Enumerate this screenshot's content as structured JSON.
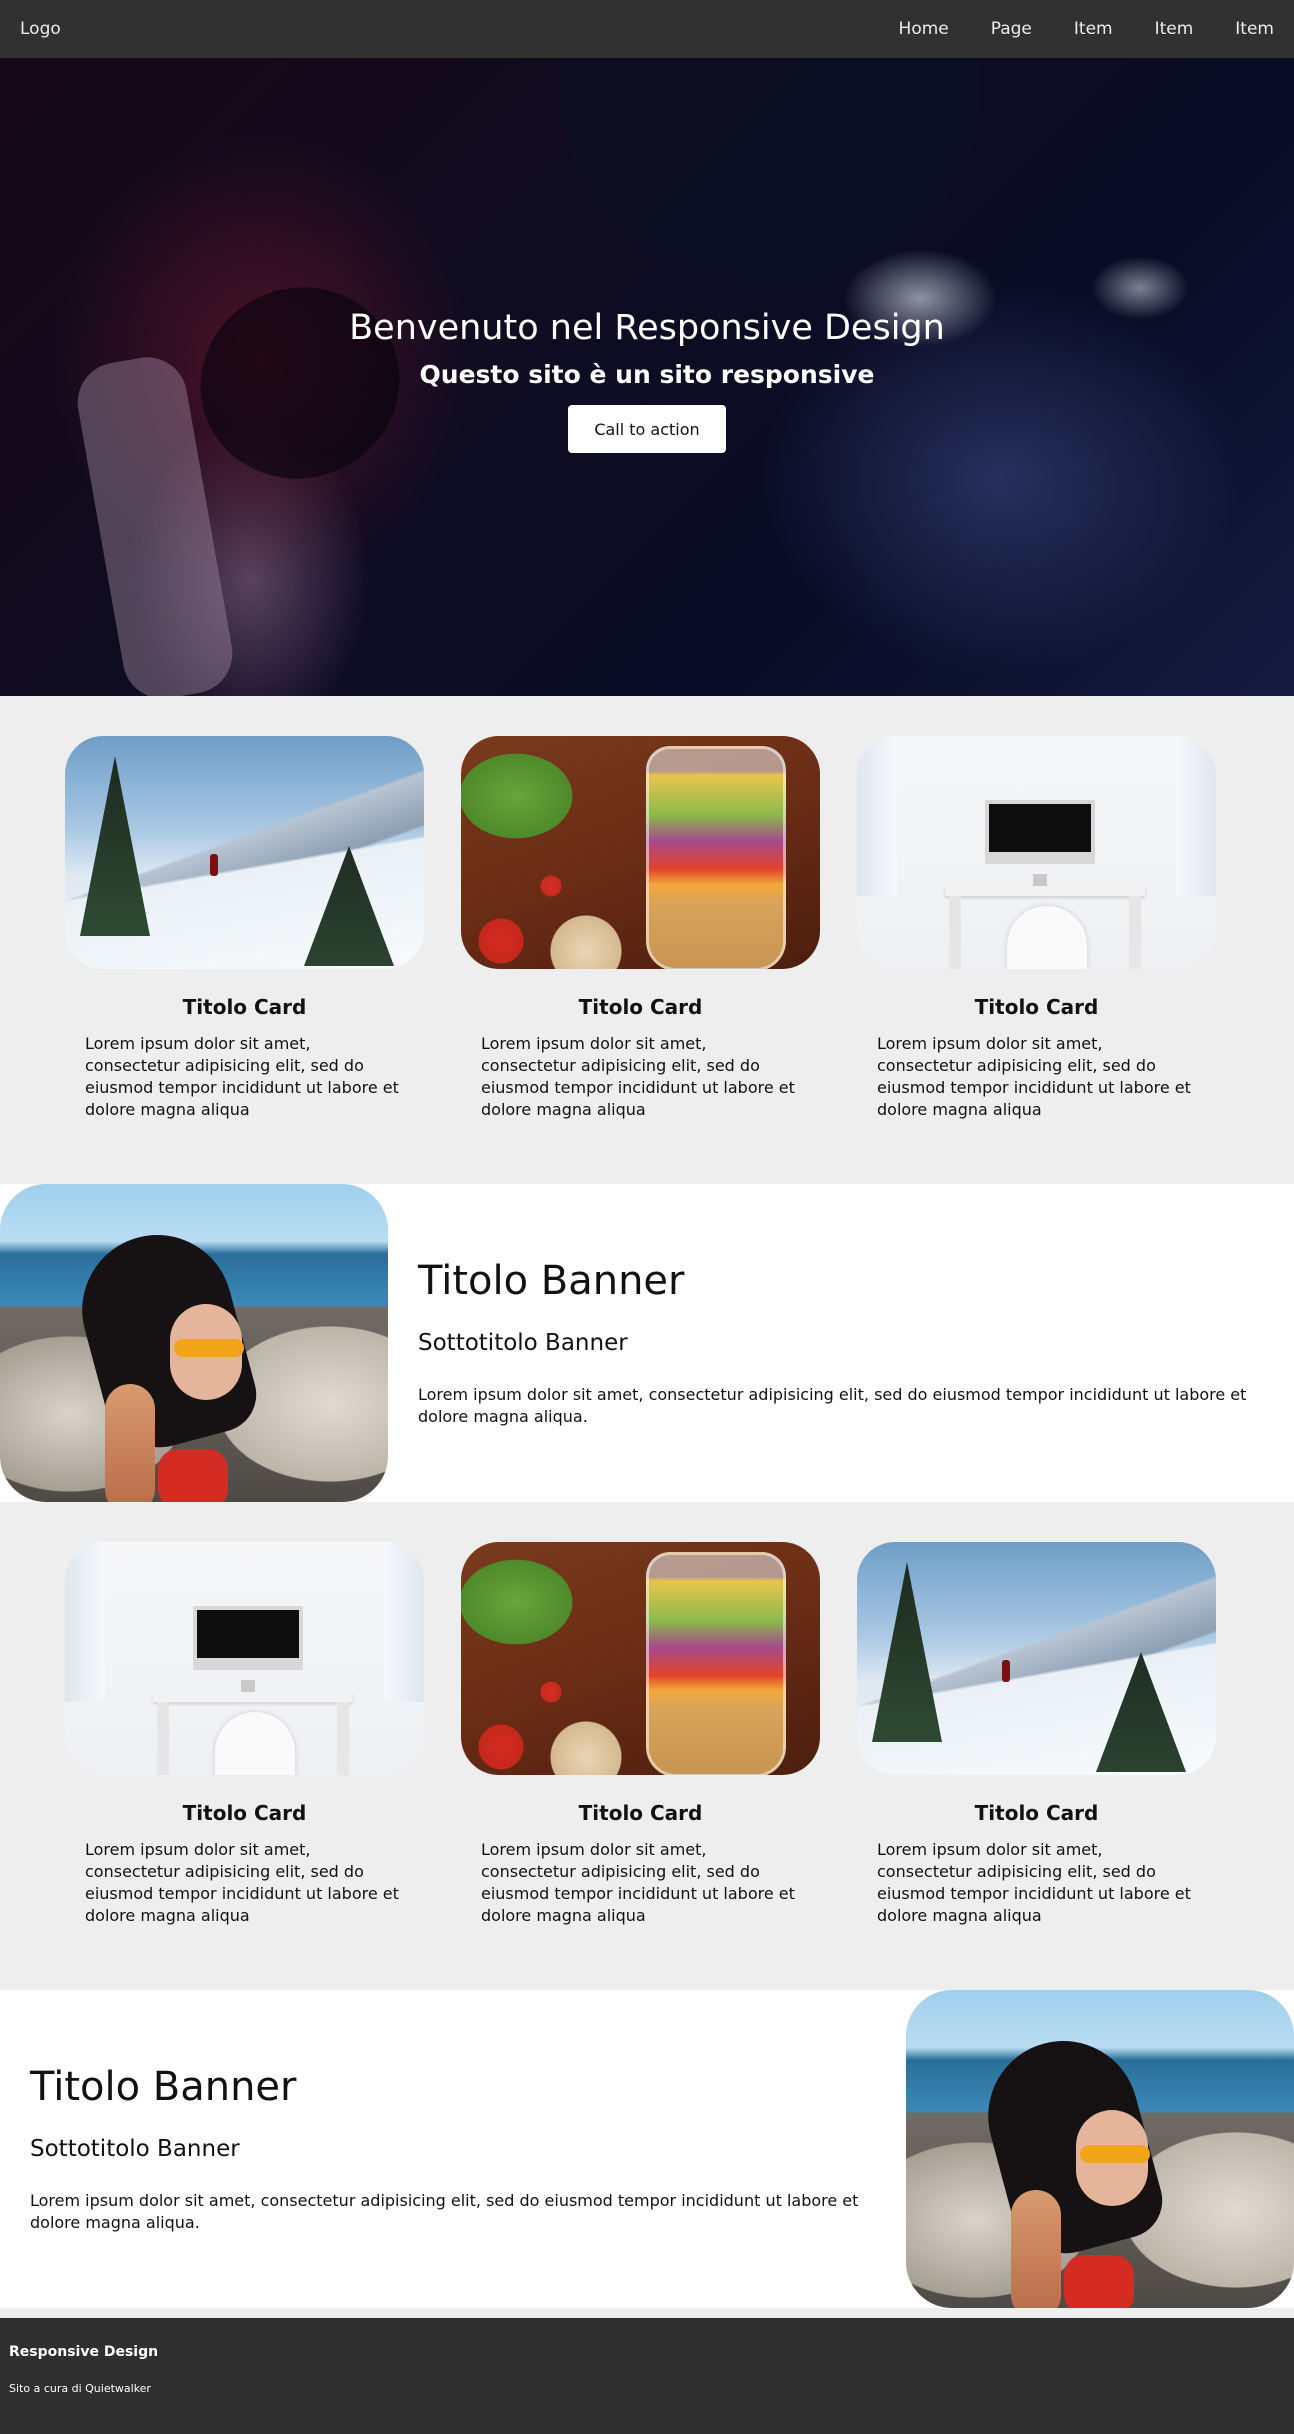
{
  "navbar": {
    "logo": "Logo",
    "links": [
      "Home",
      "Page",
      "Item",
      "Item",
      "Item"
    ]
  },
  "hero": {
    "title": "Benvenuto nel Responsive Design",
    "subtitle": "Questo sito è un sito responsive",
    "cta_label": "Call to action"
  },
  "cards_section_1": {
    "cards": [
      {
        "image": "snowy-mountain-hiker",
        "title": "Titolo Card",
        "text": "Lorem ipsum dolor sit amet, consectetur adipisicing elit, sed do eiusmod tempor incididunt ut labore et dolore magna aliqua"
      },
      {
        "image": "salad-jar",
        "title": "Titolo Card",
        "text": "Lorem ipsum dolor sit amet, consectetur adipisicing elit, sed do eiusmod tempor incididunt ut labore et dolore magna aliqua"
      },
      {
        "image": "white-desk-computer",
        "title": "Titolo Card",
        "text": "Lorem ipsum dolor sit amet, consectetur adipisicing elit, sed do eiusmod tempor incididunt ut labore et dolore magna aliqua"
      }
    ]
  },
  "banner_1": {
    "image": "woman-sunglasses-beach",
    "title": "Titolo Banner",
    "subtitle": "Sottotitolo Banner",
    "body": "Lorem ipsum dolor sit amet, consectetur adipisicing elit, sed do eiusmod tempor incididunt ut labore et dolore magna aliqua."
  },
  "cards_section_2": {
    "cards": [
      {
        "image": "white-desk-computer",
        "title": "Titolo Card",
        "text": "Lorem ipsum dolor sit amet, consectetur adipisicing elit, sed do eiusmod tempor incididunt ut labore et dolore magna aliqua"
      },
      {
        "image": "salad-jar",
        "title": "Titolo Card",
        "text": "Lorem ipsum dolor sit amet, consectetur adipisicing elit, sed do eiusmod tempor incididunt ut labore et dolore magna aliqua"
      },
      {
        "image": "snowy-mountain-hiker",
        "title": "Titolo Card",
        "text": "Lorem ipsum dolor sit amet, consectetur adipisicing elit, sed do eiusmod tempor incididunt ut labore et dolore magna aliqua"
      }
    ]
  },
  "banner_2": {
    "image": "woman-sunglasses-beach",
    "title": "Titolo Banner",
    "subtitle": "Sottotitolo Banner",
    "body": "Lorem ipsum dolor sit amet, consectetur adipisicing elit, sed do eiusmod tempor incididunt ut labore et dolore magna aliqua."
  },
  "footer": {
    "title": "Responsive Design",
    "text": "Sito a cura di Quietwalker"
  },
  "colors": {
    "navbar_bg": "#313131",
    "section_bg": "#eeeeee",
    "banner_bg": "#ffffff",
    "footer_bg": "#2f2f2f"
  }
}
